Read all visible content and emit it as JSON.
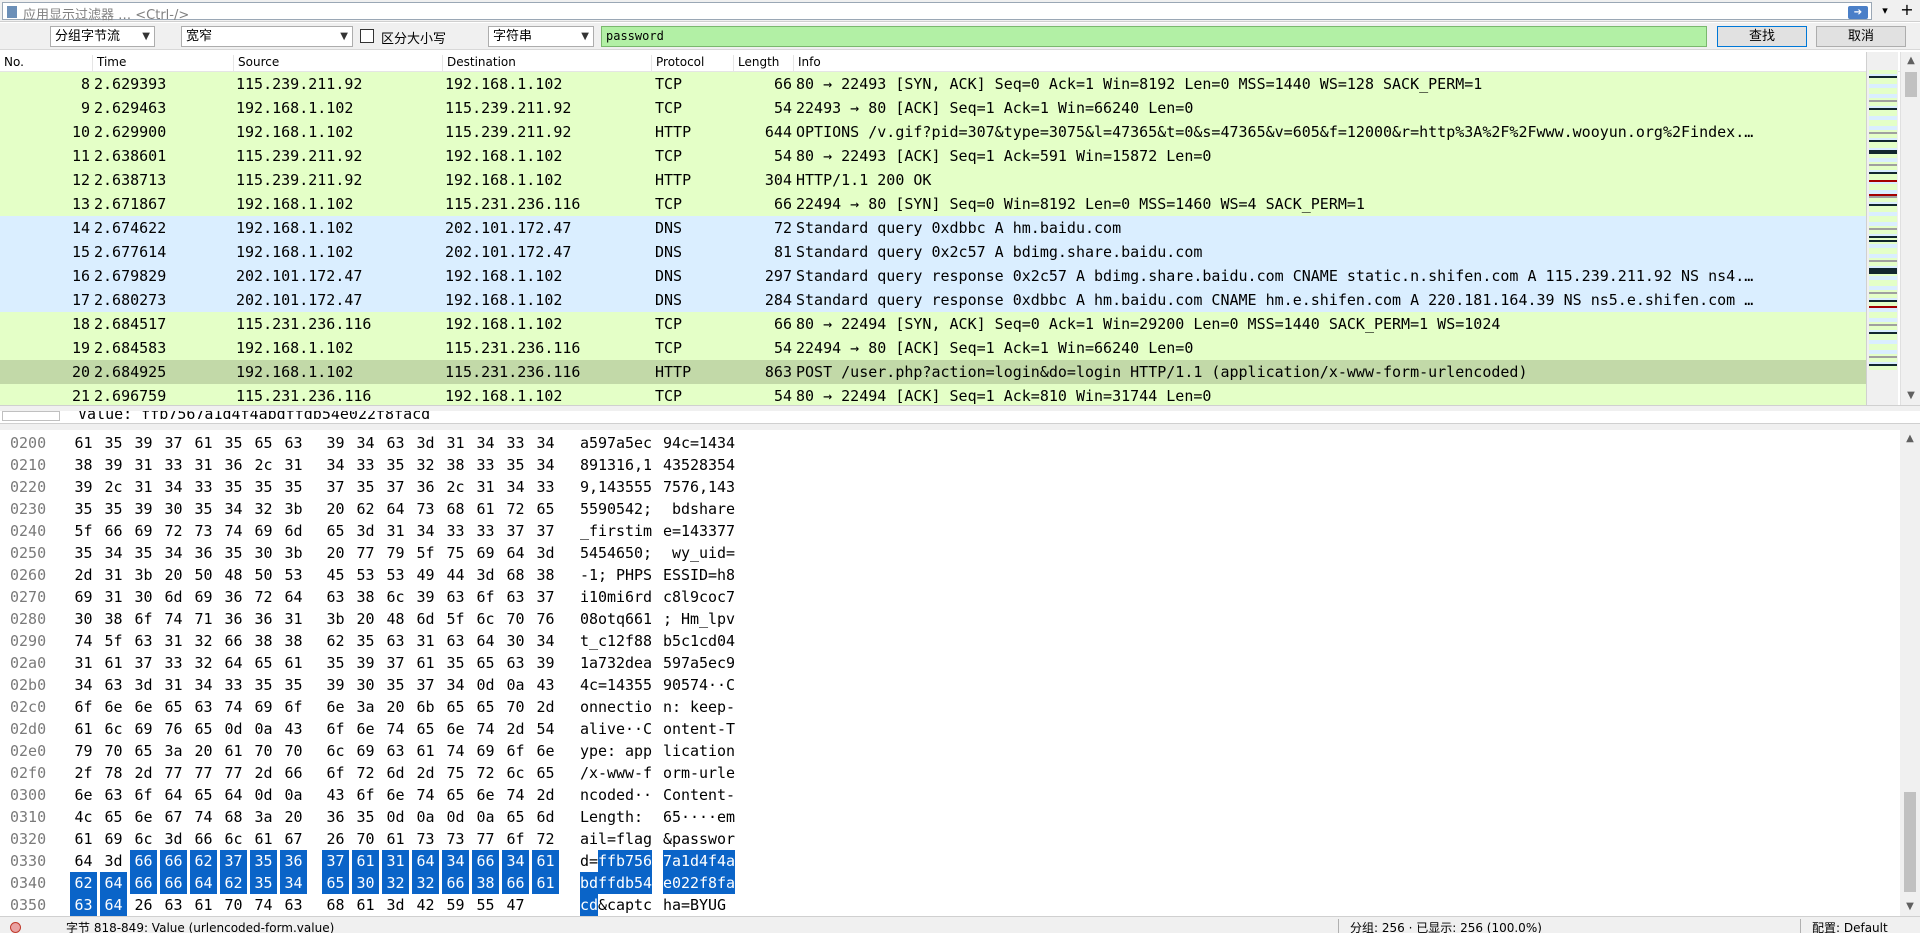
{
  "filter_bar": {
    "placeholder": "应用显示过滤器 … <Ctrl-/>"
  },
  "find_bar": {
    "search_in": "分组字节流",
    "charset": "宽窄",
    "case_sensitive_label": "区分大小写",
    "search_type": "字符串",
    "search_text": "password",
    "find_button": "查找",
    "cancel_button": "取消"
  },
  "packet_list": {
    "columns": [
      "No.",
      "Time",
      "Source",
      "Destination",
      "Protocol",
      "Length",
      "Info"
    ],
    "rows": [
      {
        "no": "8",
        "time": "2.629393",
        "src": "115.239.211.92",
        "dst": "192.168.1.102",
        "proto": "TCP",
        "len": "66",
        "info": "80 → 22493 [SYN, ACK] Seq=0 Ack=1 Win=8192 Len=0 MSS=1440 WS=128 SACK_PERM=1",
        "color": "#e4ffc7"
      },
      {
        "no": "9",
        "time": "2.629463",
        "src": "192.168.1.102",
        "dst": "115.239.211.92",
        "proto": "TCP",
        "len": "54",
        "info": "22493 → 80 [ACK] Seq=1 Ack=1 Win=66240 Len=0",
        "color": "#e4ffc7"
      },
      {
        "no": "10",
        "time": "2.629900",
        "src": "192.168.1.102",
        "dst": "115.239.211.92",
        "proto": "HTTP",
        "len": "644",
        "info": "OPTIONS /v.gif?pid=307&type=3075&l=47365&t=0&s=47365&v=605&f=12000&r=http%3A%2F%2Fwww.wooyun.org%2Findex.…",
        "color": "#e4ffc7"
      },
      {
        "no": "11",
        "time": "2.638601",
        "src": "115.239.211.92",
        "dst": "192.168.1.102",
        "proto": "TCP",
        "len": "54",
        "info": "80 → 22493 [ACK] Seq=1 Ack=591 Win=15872 Len=0",
        "color": "#e4ffc7"
      },
      {
        "no": "12",
        "time": "2.638713",
        "src": "115.239.211.92",
        "dst": "192.168.1.102",
        "proto": "HTTP",
        "len": "304",
        "info": "HTTP/1.1 200 OK",
        "color": "#e4ffc7"
      },
      {
        "no": "13",
        "time": "2.671867",
        "src": "192.168.1.102",
        "dst": "115.231.236.116",
        "proto": "TCP",
        "len": "66",
        "info": "22494 → 80 [SYN] Seq=0 Win=8192 Len=0 MSS=1460 WS=4 SACK_PERM=1",
        "color": "#e4ffc7"
      },
      {
        "no": "14",
        "time": "2.674622",
        "src": "192.168.1.102",
        "dst": "202.101.172.47",
        "proto": "DNS",
        "len": "72",
        "info": "Standard query 0xdbbc A hm.baidu.com",
        "color": "#daeeff"
      },
      {
        "no": "15",
        "time": "2.677614",
        "src": "192.168.1.102",
        "dst": "202.101.172.47",
        "proto": "DNS",
        "len": "81",
        "info": "Standard query 0x2c57 A bdimg.share.baidu.com",
        "color": "#daeeff"
      },
      {
        "no": "16",
        "time": "2.679829",
        "src": "202.101.172.47",
        "dst": "192.168.1.102",
        "proto": "DNS",
        "len": "297",
        "info": "Standard query response 0x2c57 A bdimg.share.baidu.com CNAME static.n.shifen.com A 115.239.211.92 NS ns4.…",
        "color": "#daeeff"
      },
      {
        "no": "17",
        "time": "2.680273",
        "src": "202.101.172.47",
        "dst": "192.168.1.102",
        "proto": "DNS",
        "len": "284",
        "info": "Standard query response 0xdbbc A hm.baidu.com CNAME hm.e.shifen.com A 220.181.164.39 NS ns5.e.shifen.com …",
        "color": "#daeeff"
      },
      {
        "no": "18",
        "time": "2.684517",
        "src": "115.231.236.116",
        "dst": "192.168.1.102",
        "proto": "TCP",
        "len": "66",
        "info": "80 → 22494 [SYN, ACK] Seq=0 Ack=1 Win=29200 Len=0 MSS=1440 SACK_PERM=1 WS=1024",
        "color": "#e4ffc7"
      },
      {
        "no": "19",
        "time": "2.684583",
        "src": "192.168.1.102",
        "dst": "115.231.236.116",
        "proto": "TCP",
        "len": "54",
        "info": "22494 → 80 [ACK] Seq=1 Ack=1 Win=66240 Len=0",
        "color": "#e4ffc7"
      },
      {
        "no": "20",
        "time": "2.684925",
        "src": "192.168.1.102",
        "dst": "115.231.236.116",
        "proto": "HTTP",
        "len": "863",
        "info": "POST /user.php?action=login&do=login HTTP/1.1  (application/x-www-form-urlencoded)",
        "color": "#c2d9a8",
        "selected": true
      },
      {
        "no": "21",
        "time": "2.696759",
        "src": "115.231.236.116",
        "dst": "192.168.1.102",
        "proto": "TCP",
        "len": "54",
        "info": "80 → 22494 [ACK] Seq=1 Ack=810 Win=31744 Len=0",
        "color": "#e4ffc7"
      }
    ]
  },
  "detail_pane": {
    "text": "Value: ffb7567a1d4f4abdffdb54e022f8facd"
  },
  "bytes_pane": {
    "rows": [
      {
        "off": "0200",
        "hex": [
          "61",
          "35",
          "39",
          "37",
          "61",
          "35",
          "65",
          "63",
          "39",
          "34",
          "63",
          "3d",
          "31",
          "34",
          "33",
          "34"
        ],
        "ascii": "a597a5ec94c=1434"
      },
      {
        "off": "0210",
        "hex": [
          "38",
          "39",
          "31",
          "33",
          "31",
          "36",
          "2c",
          "31",
          "34",
          "33",
          "35",
          "32",
          "38",
          "33",
          "35",
          "34"
        ],
        "ascii": "891316,143528354"
      },
      {
        "off": "0220",
        "hex": [
          "39",
          "2c",
          "31",
          "34",
          "33",
          "35",
          "35",
          "35",
          "37",
          "35",
          "37",
          "36",
          "2c",
          "31",
          "34",
          "33"
        ],
        "ascii": "9,1435557576,143"
      },
      {
        "off": "0230",
        "hex": [
          "35",
          "35",
          "39",
          "30",
          "35",
          "34",
          "32",
          "3b",
          "20",
          "62",
          "64",
          "73",
          "68",
          "61",
          "72",
          "65"
        ],
        "ascii": "5590542; bdshare"
      },
      {
        "off": "0240",
        "hex": [
          "5f",
          "66",
          "69",
          "72",
          "73",
          "74",
          "69",
          "6d",
          "65",
          "3d",
          "31",
          "34",
          "33",
          "33",
          "37",
          "37"
        ],
        "ascii": "_firstime=143377"
      },
      {
        "off": "0250",
        "hex": [
          "35",
          "34",
          "35",
          "34",
          "36",
          "35",
          "30",
          "3b",
          "20",
          "77",
          "79",
          "5f",
          "75",
          "69",
          "64",
          "3d"
        ],
        "ascii": "5454650; wy_uid="
      },
      {
        "off": "0260",
        "hex": [
          "2d",
          "31",
          "3b",
          "20",
          "50",
          "48",
          "50",
          "53",
          "45",
          "53",
          "53",
          "49",
          "44",
          "3d",
          "68",
          "38"
        ],
        "ascii": "-1; PHPSESSID=h8"
      },
      {
        "off": "0270",
        "hex": [
          "69",
          "31",
          "30",
          "6d",
          "69",
          "36",
          "72",
          "64",
          "63",
          "38",
          "6c",
          "39",
          "63",
          "6f",
          "63",
          "37"
        ],
        "ascii": "i10mi6rdc8l9coc7"
      },
      {
        "off": "0280",
        "hex": [
          "30",
          "38",
          "6f",
          "74",
          "71",
          "36",
          "36",
          "31",
          "3b",
          "20",
          "48",
          "6d",
          "5f",
          "6c",
          "70",
          "76"
        ],
        "ascii": "08otq661; Hm_lpv"
      },
      {
        "off": "0290",
        "hex": [
          "74",
          "5f",
          "63",
          "31",
          "32",
          "66",
          "38",
          "38",
          "62",
          "35",
          "63",
          "31",
          "63",
          "64",
          "30",
          "34"
        ],
        "ascii": "t_c12f88b5c1cd04"
      },
      {
        "off": "02a0",
        "hex": [
          "31",
          "61",
          "37",
          "33",
          "32",
          "64",
          "65",
          "61",
          "35",
          "39",
          "37",
          "61",
          "35",
          "65",
          "63",
          "39"
        ],
        "ascii": "1a732dea597a5ec9"
      },
      {
        "off": "02b0",
        "hex": [
          "34",
          "63",
          "3d",
          "31",
          "34",
          "33",
          "35",
          "35",
          "39",
          "30",
          "35",
          "37",
          "34",
          "0d",
          "0a",
          "43"
        ],
        "ascii": "4c=1435590574··C"
      },
      {
        "off": "02c0",
        "hex": [
          "6f",
          "6e",
          "6e",
          "65",
          "63",
          "74",
          "69",
          "6f",
          "6e",
          "3a",
          "20",
          "6b",
          "65",
          "65",
          "70",
          "2d"
        ],
        "ascii": "onnection: keep-"
      },
      {
        "off": "02d0",
        "hex": [
          "61",
          "6c",
          "69",
          "76",
          "65",
          "0d",
          "0a",
          "43",
          "6f",
          "6e",
          "74",
          "65",
          "6e",
          "74",
          "2d",
          "54"
        ],
        "ascii": "alive··Content-T"
      },
      {
        "off": "02e0",
        "hex": [
          "79",
          "70",
          "65",
          "3a",
          "20",
          "61",
          "70",
          "70",
          "6c",
          "69",
          "63",
          "61",
          "74",
          "69",
          "6f",
          "6e"
        ],
        "ascii": "ype: application"
      },
      {
        "off": "02f0",
        "hex": [
          "2f",
          "78",
          "2d",
          "77",
          "77",
          "77",
          "2d",
          "66",
          "6f",
          "72",
          "6d",
          "2d",
          "75",
          "72",
          "6c",
          "65"
        ],
        "ascii": "/x-www-form-urle"
      },
      {
        "off": "0300",
        "hex": [
          "6e",
          "63",
          "6f",
          "64",
          "65",
          "64",
          "0d",
          "0a",
          "43",
          "6f",
          "6e",
          "74",
          "65",
          "6e",
          "74",
          "2d"
        ],
        "ascii": "ncoded··Content-"
      },
      {
        "off": "0310",
        "hex": [
          "4c",
          "65",
          "6e",
          "67",
          "74",
          "68",
          "3a",
          "20",
          "36",
          "35",
          "0d",
          "0a",
          "0d",
          "0a",
          "65",
          "6d"
        ],
        "ascii": "Length: 65····em"
      },
      {
        "off": "0320",
        "hex": [
          "61",
          "69",
          "6c",
          "3d",
          "66",
          "6c",
          "61",
          "67",
          "26",
          "70",
          "61",
          "73",
          "73",
          "77",
          "6f",
          "72"
        ],
        "ascii": "ail=flag&passwor"
      },
      {
        "off": "0330",
        "hex": [
          "64",
          "3d",
          "66",
          "66",
          "62",
          "37",
          "35",
          "36",
          "37",
          "61",
          "31",
          "64",
          "34",
          "66",
          "34",
          "61"
        ],
        "ascii": "d=ffb7567a1d4f4a",
        "sel_from": 2,
        "sel_to": 15
      },
      {
        "off": "0340",
        "hex": [
          "62",
          "64",
          "66",
          "66",
          "64",
          "62",
          "35",
          "34",
          "65",
          "30",
          "32",
          "32",
          "66",
          "38",
          "66",
          "61"
        ],
        "ascii": "bdffdb54e022f8fa",
        "sel_from": 0,
        "sel_to": 15
      },
      {
        "off": "0350",
        "hex": [
          "63",
          "64",
          "26",
          "63",
          "61",
          "70",
          "74",
          "63",
          "68",
          "61",
          "3d",
          "42",
          "59",
          "55",
          "47"
        ],
        "ascii": "cd&captcha=BYUG",
        "sel_from": 0,
        "sel_to": 1
      }
    ]
  },
  "status_bar": {
    "left_text": "字节 818-849: Value (urlencoded-form.value)",
    "middle_text": "分组: 256 · 已显示: 256 (100.0%)",
    "right_text": "配置: Default"
  }
}
